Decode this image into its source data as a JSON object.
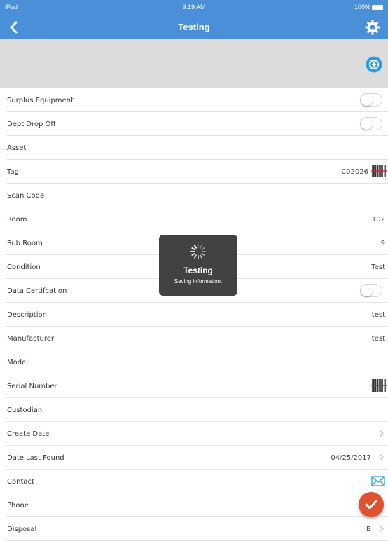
{
  "status_bar": {
    "device": "iPad",
    "time": "9:19 AM",
    "battery": "100%"
  },
  "nav": {
    "title": "Testing",
    "back_icon": "chevron-left-icon",
    "settings_icon": "gear-icon"
  },
  "banner": {
    "add_icon": "plus-circle-icon"
  },
  "rows": [
    {
      "label": "Surplus Equipment",
      "control": "toggle",
      "on": false
    },
    {
      "label": "Dept Drop Off",
      "control": "toggle",
      "on": false
    },
    {
      "label": "Asset"
    },
    {
      "label": "Tag",
      "value": "C02026",
      "control": "barcode"
    },
    {
      "label": "Scan Code"
    },
    {
      "label": "Room",
      "value": "102"
    },
    {
      "label": "Sub Room",
      "value": "9"
    },
    {
      "label": "Condition",
      "value": "Test"
    },
    {
      "label": "Data Certifcation",
      "control": "toggle",
      "on": false
    },
    {
      "label": "Description",
      "value": "test"
    },
    {
      "label": "Manufacturer",
      "value": "test"
    },
    {
      "label": "Model"
    },
    {
      "label": "Serial Number",
      "control": "barcode"
    },
    {
      "label": "Custodian"
    },
    {
      "label": "Create Date",
      "control": "chevron"
    },
    {
      "label": "Date Last Found",
      "value": "04/25/2017",
      "control": "chevron"
    },
    {
      "label": "Contact",
      "control": "mail"
    },
    {
      "label": "Phone"
    },
    {
      "label": "Disposal",
      "value": "B",
      "control": "chevron"
    }
  ],
  "hud": {
    "title": "Testing",
    "message": "Saving information."
  },
  "colors": {
    "nav": "#4a90d9",
    "accent": "#2a9de8",
    "fab": "#e0522d"
  }
}
